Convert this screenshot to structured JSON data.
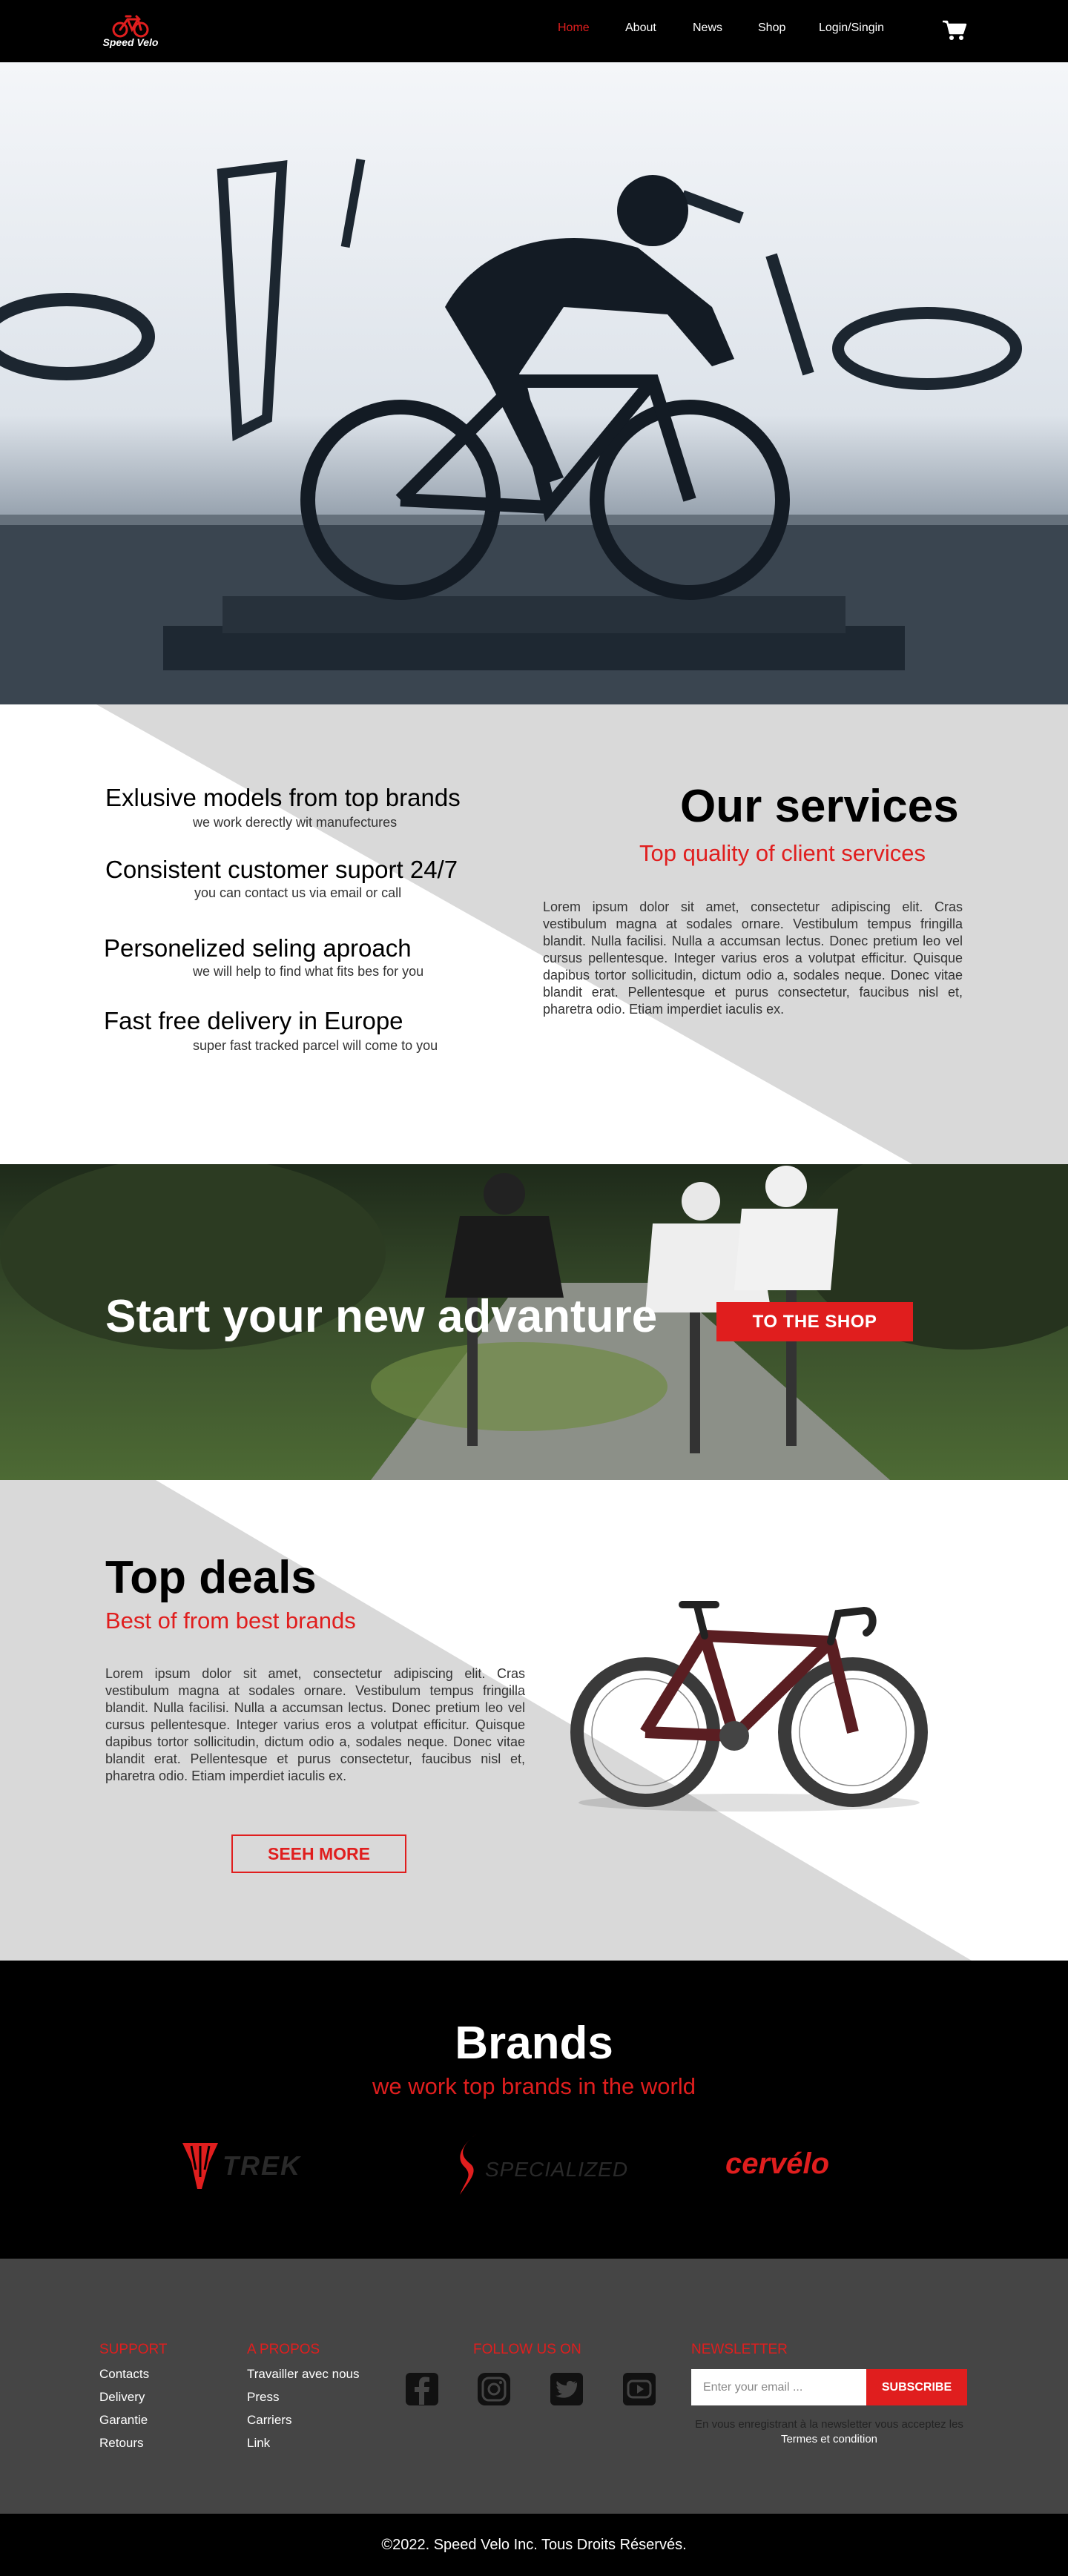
{
  "brand": {
    "name": "Speed Velo"
  },
  "nav": {
    "items": [
      {
        "label": "Home",
        "active": true
      },
      {
        "label": "About",
        "active": false
      },
      {
        "label": "News",
        "active": false
      },
      {
        "label": "Shop",
        "active": false
      },
      {
        "label": "Login/Singin",
        "active": false
      }
    ],
    "cart_icon": "cart-icon"
  },
  "services": {
    "features": [
      {
        "title": "Exlusive models from top brands",
        "subtitle": "we work derectly wit manufectures"
      },
      {
        "title": "Consistent customer suport 24/7",
        "subtitle": "you can contact us via email or call"
      },
      {
        "title": "Personelized seling aproach",
        "subtitle": "we will help to find what fits bes for you"
      },
      {
        "title": "Fast free delivery in Europe",
        "subtitle": "super fast tracked parcel will come to you"
      }
    ],
    "title": "Our services",
    "subtitle": "Top quality of client services",
    "body": "Lorem ipsum dolor sit amet, consectetur adipiscing elit. Cras vestibulum magna at sodales ornare. Vestibulum tempus fringilla blandit. Nulla facilisi. Nulla a accumsan lectus. Donec pretium leo vel cursus pellentesque. Integer varius eros a volutpat efficitur. Quisque dapibus tortor sollicitudin, dictum odio a, sodales neque. Donec vitae blandit erat. Pellentesque et purus consectetur, faucibus nisl et, pharetra odio. Etiam imperdiet iaculis ex."
  },
  "banner": {
    "title": "Start your new advanture",
    "button": "TO THE  SHOP"
  },
  "deals": {
    "title": "Top deals",
    "subtitle": "Best of from best brands",
    "body": "Lorem ipsum dolor sit amet, consectetur adipiscing elit. Cras vestibulum magna at sodales ornare. Vestibulum tempus fringilla blandit. Nulla facilisi. Nulla a accumsan lectus. Donec pretium leo vel cursus pellentesque. Integer varius eros a volutpat efficitur. Quisque dapibus tortor sollicitudin, dictum odio a, sodales neque. Donec vitae blandit erat. Pellentesque et purus consectetur, faucibus nisl et, pharetra odio. Etiam imperdiet iaculis ex.",
    "button": "SEEH MORE"
  },
  "brands": {
    "title": "Brands",
    "subtitle": "we work top brands in the world",
    "logos": [
      "TREK",
      "SPECIALIZED",
      "cervélo"
    ]
  },
  "footer": {
    "support": {
      "title": "SUPPORT",
      "links": [
        "Contacts",
        "Delivery",
        "Garantie",
        "Retours"
      ]
    },
    "apropos": {
      "title": "A PROPOS",
      "links": [
        "Travailler avec nous",
        "Press",
        "Carriers",
        "Link"
      ]
    },
    "follow": {
      "title": "FOLLOW US ON",
      "icons": [
        "facebook-icon",
        "instagram-icon",
        "twitter-icon",
        "youtube-icon"
      ]
    },
    "newsletter": {
      "title": "NEWSLETTER",
      "placeholder": "Enter your email ...",
      "button": "SUBSCRIBE",
      "note": "En vous enregistrant à la newsletter vous acceptez les",
      "terms": "Termes et condition"
    }
  },
  "copyright": "©2022. Speed Velo Inc. Tous Droits Réservés.",
  "colors": {
    "accent": "#e01e1e",
    "dark": "#000000",
    "footer": "#454545",
    "band": "#d9d9d9"
  }
}
